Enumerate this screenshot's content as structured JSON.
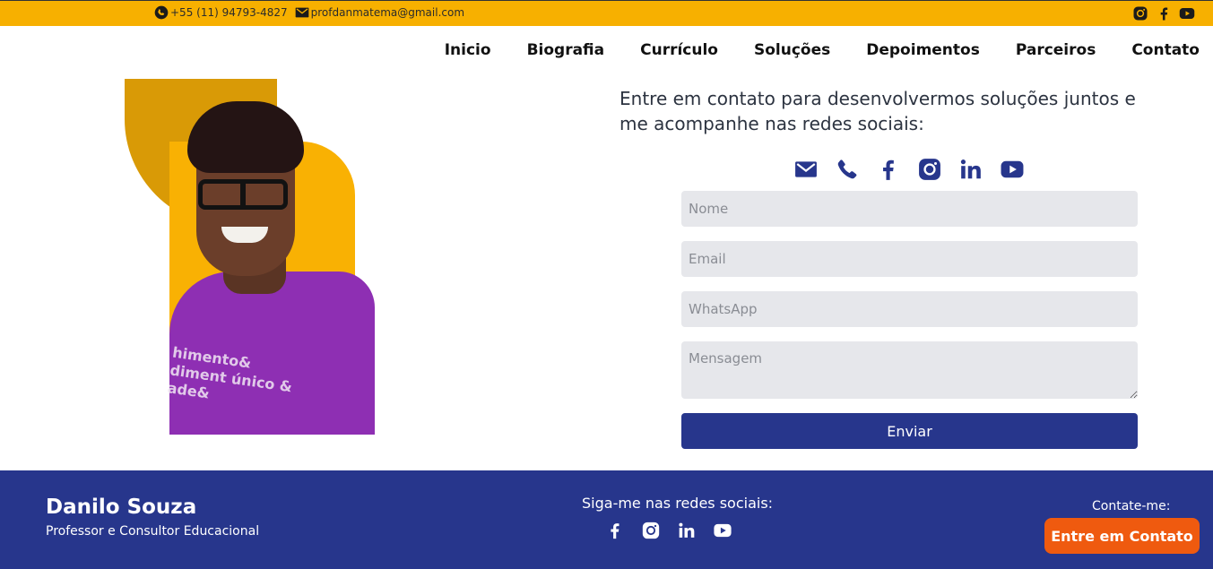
{
  "topbar": {
    "phone": "+55 (11) 94793-4827",
    "email": "profdanmatema@gmail.com",
    "icons": [
      "whatsapp-icon",
      "email-icon",
      "instagram-icon",
      "facebook-icon",
      "youtube-icon"
    ],
    "color": "#f7b000"
  },
  "nav": {
    "items": [
      "Inicio",
      "Biografia",
      "Currículo",
      "Soluções",
      "Depoimentos",
      "Parceiros",
      "Contato"
    ]
  },
  "photo": {
    "shirt_text": "himento&\ndiment único &\nade&"
  },
  "contact": {
    "intro": "Entre em contato para desenvolvermos soluções juntos e me acompanhe nas redes sociais:",
    "icons": [
      "email-icon",
      "phone-icon",
      "facebook-icon",
      "instagram-icon",
      "linkedin-icon",
      "youtube-icon"
    ],
    "icon_color": "#27368c"
  },
  "form": {
    "name_placeholder": "Nome",
    "email_placeholder": "Email",
    "whatsapp_placeholder": "WhatsApp",
    "message_placeholder": "Mensagem",
    "submit_label": "Enviar"
  },
  "footer": {
    "name": "Danilo Souza",
    "role": "Professor e Consultor Educacional",
    "follow_label": "Siga-me nas redes sociais:",
    "social_icons": [
      "facebook-icon",
      "instagram-icon",
      "linkedin-icon",
      "youtube-icon"
    ],
    "contact_label": "Contate-me:",
    "cta_label": "Entre em Contato",
    "background": "#27368c",
    "cta_color": "#ef5a0f"
  }
}
